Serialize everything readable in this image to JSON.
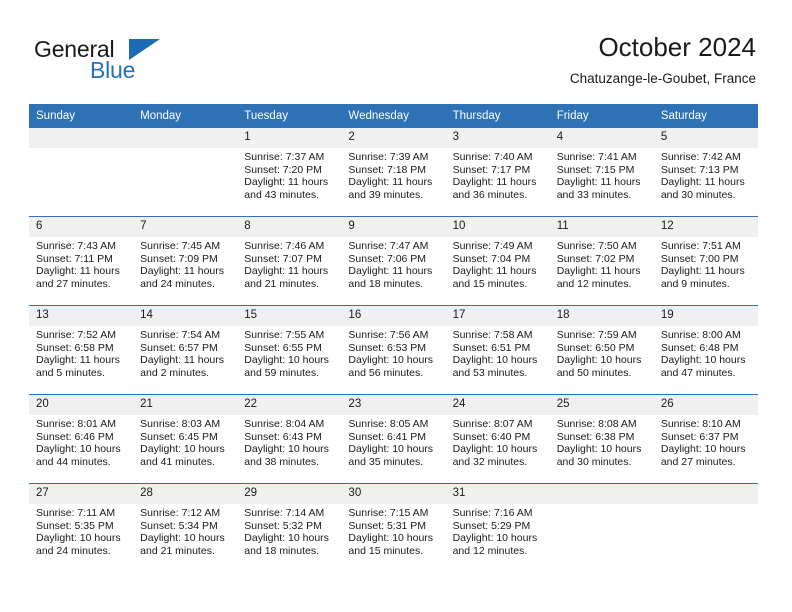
{
  "brand": {
    "name_part1": "General",
    "name_part2": "Blue"
  },
  "header": {
    "title": "October 2024",
    "location": "Chatuzange-le-Goubet, France"
  },
  "calendar": {
    "weekday_headers": [
      "Sunday",
      "Monday",
      "Tuesday",
      "Wednesday",
      "Thursday",
      "Friday",
      "Saturday"
    ],
    "accent_color": "#2d72b5",
    "daynum_band_color": "#f0f0f0",
    "weeks": [
      [
        {
          "empty": true
        },
        {
          "empty": true
        },
        {
          "day": "1",
          "sunrise": "Sunrise: 7:37 AM",
          "sunset": "Sunset: 7:20 PM",
          "daylight_line1": "Daylight: 11 hours",
          "daylight_line2": "and 43 minutes."
        },
        {
          "day": "2",
          "sunrise": "Sunrise: 7:39 AM",
          "sunset": "Sunset: 7:18 PM",
          "daylight_line1": "Daylight: 11 hours",
          "daylight_line2": "and 39 minutes."
        },
        {
          "day": "3",
          "sunrise": "Sunrise: 7:40 AM",
          "sunset": "Sunset: 7:17 PM",
          "daylight_line1": "Daylight: 11 hours",
          "daylight_line2": "and 36 minutes."
        },
        {
          "day": "4",
          "sunrise": "Sunrise: 7:41 AM",
          "sunset": "Sunset: 7:15 PM",
          "daylight_line1": "Daylight: 11 hours",
          "daylight_line2": "and 33 minutes."
        },
        {
          "day": "5",
          "sunrise": "Sunrise: 7:42 AM",
          "sunset": "Sunset: 7:13 PM",
          "daylight_line1": "Daylight: 11 hours",
          "daylight_line2": "and 30 minutes."
        }
      ],
      [
        {
          "day": "6",
          "sunrise": "Sunrise: 7:43 AM",
          "sunset": "Sunset: 7:11 PM",
          "daylight_line1": "Daylight: 11 hours",
          "daylight_line2": "and 27 minutes."
        },
        {
          "day": "7",
          "sunrise": "Sunrise: 7:45 AM",
          "sunset": "Sunset: 7:09 PM",
          "daylight_line1": "Daylight: 11 hours",
          "daylight_line2": "and 24 minutes."
        },
        {
          "day": "8",
          "sunrise": "Sunrise: 7:46 AM",
          "sunset": "Sunset: 7:07 PM",
          "daylight_line1": "Daylight: 11 hours",
          "daylight_line2": "and 21 minutes."
        },
        {
          "day": "9",
          "sunrise": "Sunrise: 7:47 AM",
          "sunset": "Sunset: 7:06 PM",
          "daylight_line1": "Daylight: 11 hours",
          "daylight_line2": "and 18 minutes."
        },
        {
          "day": "10",
          "sunrise": "Sunrise: 7:49 AM",
          "sunset": "Sunset: 7:04 PM",
          "daylight_line1": "Daylight: 11 hours",
          "daylight_line2": "and 15 minutes."
        },
        {
          "day": "11",
          "sunrise": "Sunrise: 7:50 AM",
          "sunset": "Sunset: 7:02 PM",
          "daylight_line1": "Daylight: 11 hours",
          "daylight_line2": "and 12 minutes."
        },
        {
          "day": "12",
          "sunrise": "Sunrise: 7:51 AM",
          "sunset": "Sunset: 7:00 PM",
          "daylight_line1": "Daylight: 11 hours",
          "daylight_line2": "and 9 minutes."
        }
      ],
      [
        {
          "day": "13",
          "sunrise": "Sunrise: 7:52 AM",
          "sunset": "Sunset: 6:58 PM",
          "daylight_line1": "Daylight: 11 hours",
          "daylight_line2": "and 5 minutes."
        },
        {
          "day": "14",
          "sunrise": "Sunrise: 7:54 AM",
          "sunset": "Sunset: 6:57 PM",
          "daylight_line1": "Daylight: 11 hours",
          "daylight_line2": "and 2 minutes."
        },
        {
          "day": "15",
          "sunrise": "Sunrise: 7:55 AM",
          "sunset": "Sunset: 6:55 PM",
          "daylight_line1": "Daylight: 10 hours",
          "daylight_line2": "and 59 minutes."
        },
        {
          "day": "16",
          "sunrise": "Sunrise: 7:56 AM",
          "sunset": "Sunset: 6:53 PM",
          "daylight_line1": "Daylight: 10 hours",
          "daylight_line2": "and 56 minutes."
        },
        {
          "day": "17",
          "sunrise": "Sunrise: 7:58 AM",
          "sunset": "Sunset: 6:51 PM",
          "daylight_line1": "Daylight: 10 hours",
          "daylight_line2": "and 53 minutes."
        },
        {
          "day": "18",
          "sunrise": "Sunrise: 7:59 AM",
          "sunset": "Sunset: 6:50 PM",
          "daylight_line1": "Daylight: 10 hours",
          "daylight_line2": "and 50 minutes."
        },
        {
          "day": "19",
          "sunrise": "Sunrise: 8:00 AM",
          "sunset": "Sunset: 6:48 PM",
          "daylight_line1": "Daylight: 10 hours",
          "daylight_line2": "and 47 minutes."
        }
      ],
      [
        {
          "day": "20",
          "sunrise": "Sunrise: 8:01 AM",
          "sunset": "Sunset: 6:46 PM",
          "daylight_line1": "Daylight: 10 hours",
          "daylight_line2": "and 44 minutes."
        },
        {
          "day": "21",
          "sunrise": "Sunrise: 8:03 AM",
          "sunset": "Sunset: 6:45 PM",
          "daylight_line1": "Daylight: 10 hours",
          "daylight_line2": "and 41 minutes."
        },
        {
          "day": "22",
          "sunrise": "Sunrise: 8:04 AM",
          "sunset": "Sunset: 6:43 PM",
          "daylight_line1": "Daylight: 10 hours",
          "daylight_line2": "and 38 minutes."
        },
        {
          "day": "23",
          "sunrise": "Sunrise: 8:05 AM",
          "sunset": "Sunset: 6:41 PM",
          "daylight_line1": "Daylight: 10 hours",
          "daylight_line2": "and 35 minutes."
        },
        {
          "day": "24",
          "sunrise": "Sunrise: 8:07 AM",
          "sunset": "Sunset: 6:40 PM",
          "daylight_line1": "Daylight: 10 hours",
          "daylight_line2": "and 32 minutes."
        },
        {
          "day": "25",
          "sunrise": "Sunrise: 8:08 AM",
          "sunset": "Sunset: 6:38 PM",
          "daylight_line1": "Daylight: 10 hours",
          "daylight_line2": "and 30 minutes."
        },
        {
          "day": "26",
          "sunrise": "Sunrise: 8:10 AM",
          "sunset": "Sunset: 6:37 PM",
          "daylight_line1": "Daylight: 10 hours",
          "daylight_line2": "and 27 minutes."
        }
      ],
      [
        {
          "day": "27",
          "sunrise": "Sunrise: 7:11 AM",
          "sunset": "Sunset: 5:35 PM",
          "daylight_line1": "Daylight: 10 hours",
          "daylight_line2": "and 24 minutes."
        },
        {
          "day": "28",
          "sunrise": "Sunrise: 7:12 AM",
          "sunset": "Sunset: 5:34 PM",
          "daylight_line1": "Daylight: 10 hours",
          "daylight_line2": "and 21 minutes."
        },
        {
          "day": "29",
          "sunrise": "Sunrise: 7:14 AM",
          "sunset": "Sunset: 5:32 PM",
          "daylight_line1": "Daylight: 10 hours",
          "daylight_line2": "and 18 minutes."
        },
        {
          "day": "30",
          "sunrise": "Sunrise: 7:15 AM",
          "sunset": "Sunset: 5:31 PM",
          "daylight_line1": "Daylight: 10 hours",
          "daylight_line2": "and 15 minutes."
        },
        {
          "day": "31",
          "sunrise": "Sunrise: 7:16 AM",
          "sunset": "Sunset: 5:29 PM",
          "daylight_line1": "Daylight: 10 hours",
          "daylight_line2": "and 12 minutes."
        },
        {
          "empty": true
        },
        {
          "empty": true
        }
      ]
    ]
  }
}
